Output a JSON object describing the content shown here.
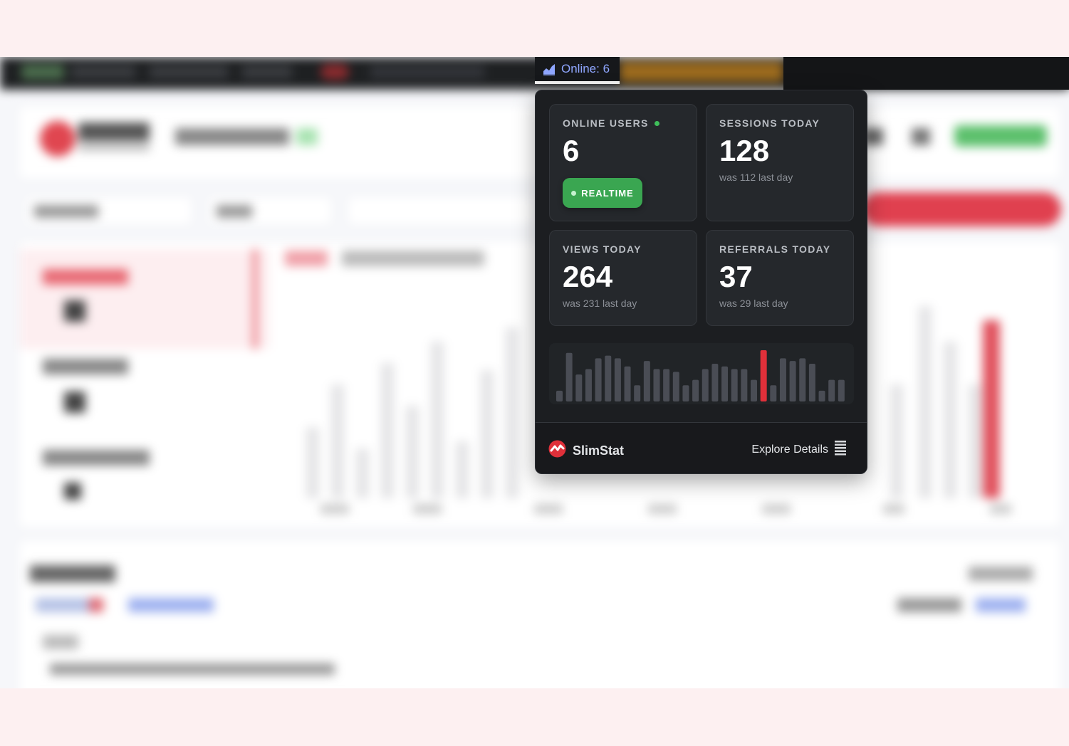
{
  "adminbar": {
    "online_label": "Online: 6"
  },
  "cards": [
    {
      "title": "ONLINE USERS",
      "value": "6",
      "badge": "REALTIME"
    },
    {
      "title": "SESSIONS TODAY",
      "value": "128",
      "subtext": "was 112 last day"
    },
    {
      "title": "VIEWS TODAY",
      "value": "264",
      "subtext": "was 231 last day"
    },
    {
      "title": "REFERRALS TODAY",
      "value": "37",
      "subtext": "was 29 last day"
    }
  ],
  "chart_data": {
    "type": "bar",
    "values": [
      2,
      9,
      5,
      6,
      8,
      8.5,
      8,
      6.5,
      3,
      7.5,
      6,
      6,
      5.5,
      3,
      4,
      6,
      7,
      6.5,
      6,
      6,
      4,
      9.5,
      3,
      8,
      7.5,
      8,
      7,
      2,
      4,
      4
    ],
    "highlight_index": 21,
    "colors": {
      "bar": "#4a4d55",
      "highlight": "#e0303a"
    }
  },
  "footer": {
    "brand": "SlimStat",
    "explore_label": "Explore Details"
  },
  "colors": {
    "accent_blue": "#8fa6ff",
    "green": "#3aa651",
    "red": "#e0303a"
  }
}
